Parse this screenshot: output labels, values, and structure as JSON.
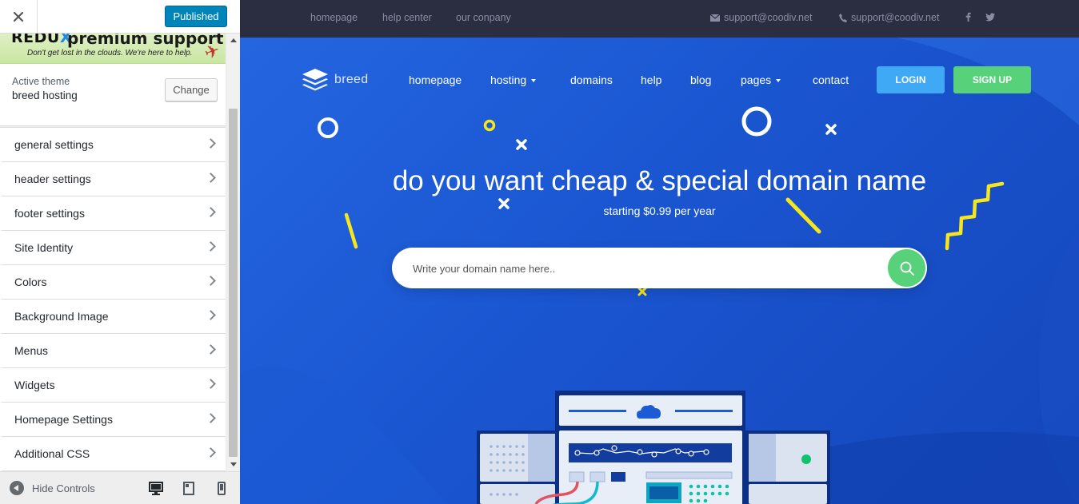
{
  "customizer": {
    "close_label": "close",
    "publish_label": "Published",
    "banner": {
      "brand": "REDU",
      "brand_x": "X",
      "title": "premium support",
      "tagline": "Don't get lost in the clouds. We're here to help."
    },
    "active_theme": {
      "label": "Active theme",
      "name": "breed hosting",
      "change_label": "Change"
    },
    "sections": [
      {
        "label": "general settings"
      },
      {
        "label": "header settings"
      },
      {
        "label": "footer settings"
      },
      {
        "label": "Site Identity"
      },
      {
        "label": "Colors"
      },
      {
        "label": "Background Image"
      },
      {
        "label": "Menus"
      },
      {
        "label": "Widgets"
      },
      {
        "label": "Homepage Settings"
      },
      {
        "label": "Additional CSS"
      }
    ],
    "footer": {
      "hide_controls_label": "Hide Controls",
      "devices": [
        "desktop-icon",
        "tablet-icon",
        "mobile-icon"
      ]
    }
  },
  "preview": {
    "topbar": {
      "links": [
        "homepage",
        "help center",
        "our conpany"
      ],
      "email": "support@coodiv.net",
      "phone": "support@coodiv.net",
      "social": [
        "facebook-icon",
        "twitter-icon"
      ]
    },
    "brand": "breed",
    "nav": [
      {
        "label": "homepage",
        "has_dropdown": false
      },
      {
        "label": "hosting",
        "has_dropdown": true
      },
      {
        "label": "domains",
        "has_dropdown": false
      },
      {
        "label": "help",
        "has_dropdown": false
      },
      {
        "label": "blog",
        "has_dropdown": false
      },
      {
        "label": "pages",
        "has_dropdown": true
      },
      {
        "label": "contact",
        "has_dropdown": false
      }
    ],
    "login_label": "LOGIN",
    "signup_label": "SIGN UP",
    "hero": {
      "title": "do you want cheap & special domain name",
      "subtitle": "starting $0.99 per year",
      "search_placeholder": "Write your domain name here.."
    },
    "colors": {
      "accent_blue": "#0085ba",
      "login": "#3fa9f5",
      "signup": "#58d17b",
      "hero_bg": "#1a55d0",
      "topbar_bg": "#2b2d40",
      "deco_yellow": "#f5e71c"
    }
  }
}
